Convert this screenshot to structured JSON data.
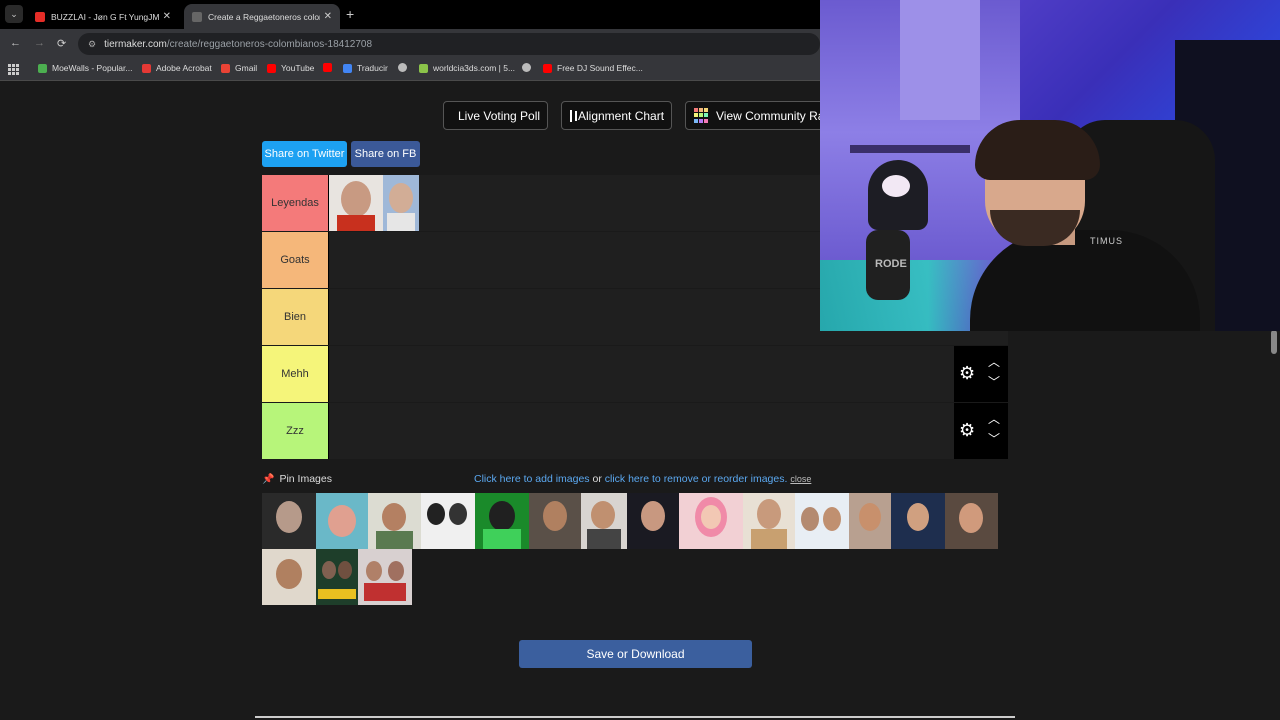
{
  "browser": {
    "tabs": [
      {
        "title": "BUZZLAI - Jøn G Ft YungJMC (V",
        "active": false,
        "favicon_color": "#e52d27"
      },
      {
        "title": "Create a Reggaetoneros colom",
        "active": true,
        "favicon_color": "#555555"
      }
    ],
    "url_host": "tiermaker.com",
    "url_path": "/create/reggaetoneros-colombianos-18412708",
    "bookmarks": [
      {
        "label": "MoeWalls - Popular...",
        "icon_color": "#4caf50"
      },
      {
        "label": "Adobe Acrobat",
        "icon_color": "#e53935"
      },
      {
        "label": "Gmail",
        "icon_color": "#ea4335"
      },
      {
        "label": "YouTube",
        "icon_color": "#ff0000"
      },
      {
        "label": "",
        "icon_color": "#ff0000"
      },
      {
        "label": "Traducir",
        "icon_color": "#4285f4"
      },
      {
        "label": "",
        "icon_color": "#bbbbbb"
      },
      {
        "label": "worldcia3ds.com | 5...",
        "icon_color": "#8bc34a"
      },
      {
        "label": "",
        "icon_color": "#bbbbbb"
      },
      {
        "label": "Free DJ Sound Effec...",
        "icon_color": "#ff0000"
      }
    ]
  },
  "toolbar": {
    "live_voting": "Live Voting Poll",
    "alignment_chart": "Alignment Chart",
    "view_community": "View Community Rank"
  },
  "share": {
    "twitter": "Share on Twitter",
    "facebook": "Share on FB"
  },
  "tiers": [
    {
      "label": "Leyendas",
      "color": "#f47a7a"
    },
    {
      "label": "Goats",
      "color": "#f5b77a"
    },
    {
      "label": "Bien",
      "color": "#f5d77a"
    },
    {
      "label": "Mehh",
      "color": "#f5f57a"
    },
    {
      "label": "Zzz",
      "color": "#b7f57a"
    }
  ],
  "pool": {
    "pin_label": "Pin Images",
    "add_link": "Click here to add images",
    "or": "or",
    "reorder_link": "click here to remove or reorder images.",
    "close": "close"
  },
  "save_button": "Save or Download",
  "webcam": {
    "mic_brand": "RODE",
    "chair_text": "TIMUS"
  }
}
